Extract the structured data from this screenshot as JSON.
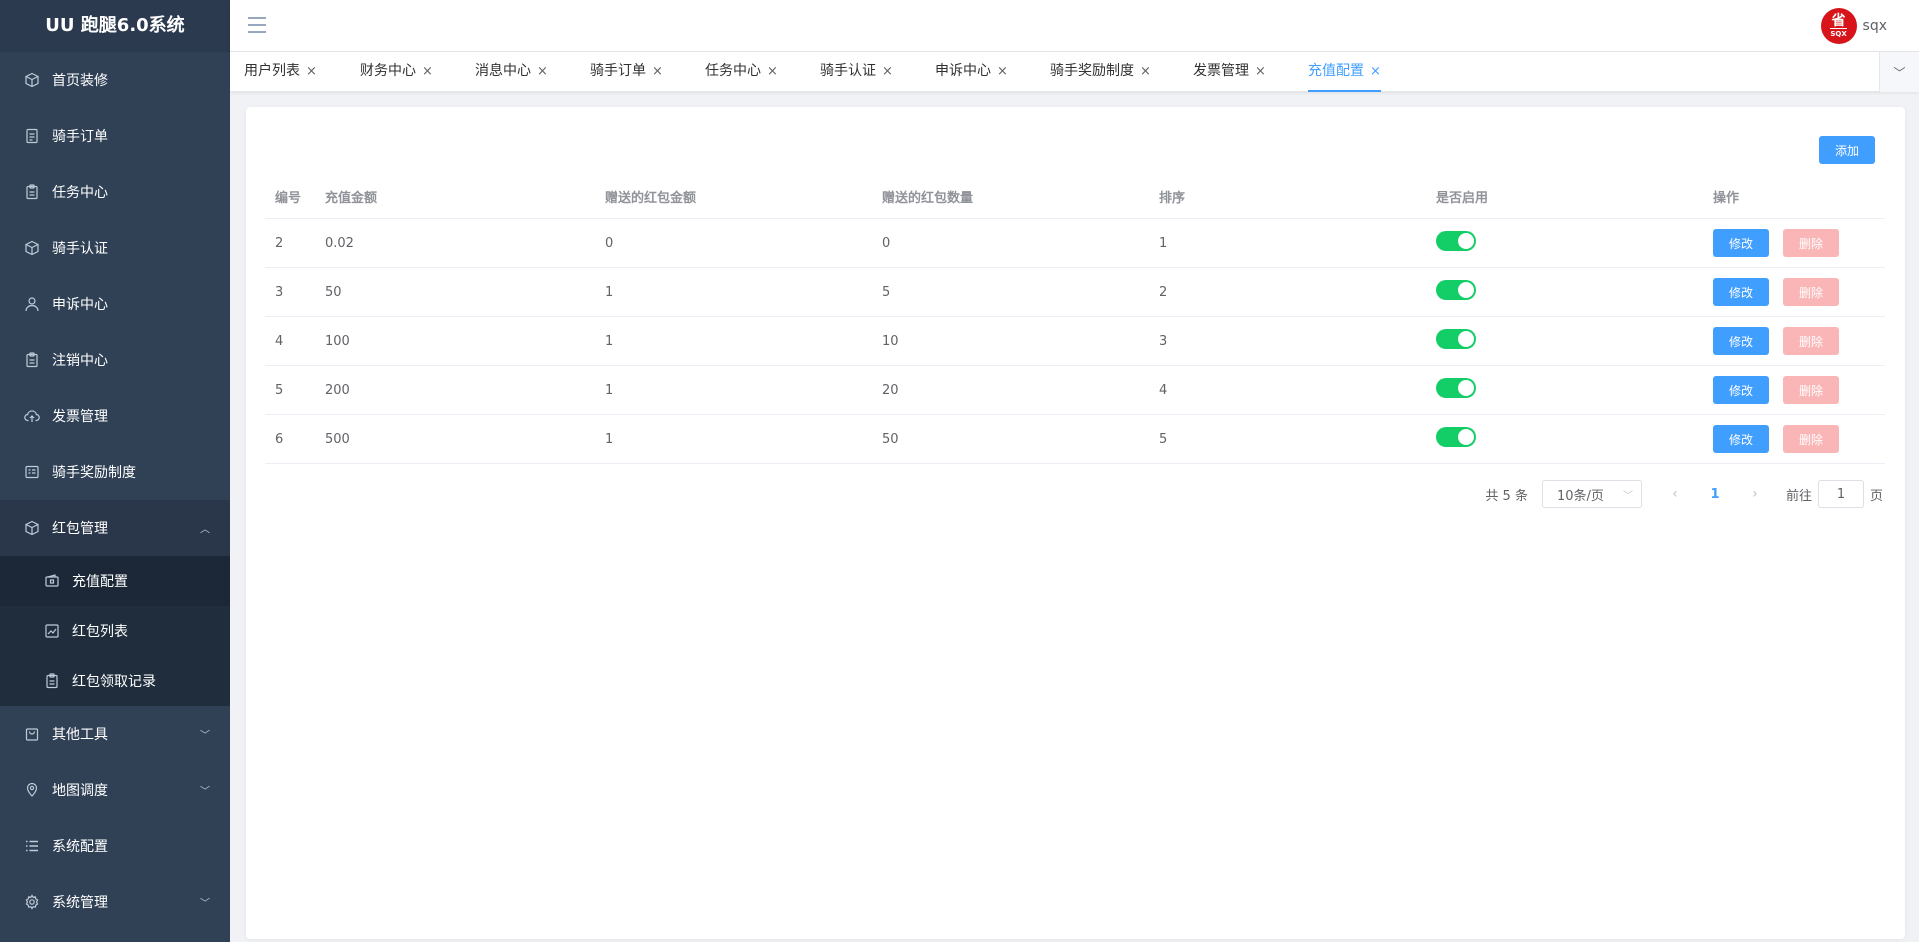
{
  "app": {
    "title": "UU 跑腿6.0系统"
  },
  "header": {
    "username": "sqx",
    "avatar_char": "省",
    "avatar_sub": "SQX"
  },
  "sidebar": {
    "items": [
      {
        "label": "首页装修",
        "icon": "cube-icon"
      },
      {
        "label": "骑手订单",
        "icon": "document-icon"
      },
      {
        "label": "任务中心",
        "icon": "clipboard-icon"
      },
      {
        "label": "骑手认证",
        "icon": "cube-icon"
      },
      {
        "label": "申诉中心",
        "icon": "user-icon"
      },
      {
        "label": "注销中心",
        "icon": "clipboard-icon"
      },
      {
        "label": "发票管理",
        "icon": "cloud-upload-icon"
      },
      {
        "label": "骑手奖励制度",
        "icon": "list-card-icon"
      }
    ],
    "group_open": {
      "label": "红包管理",
      "icon": "cube-icon",
      "arrow": "︿"
    },
    "sub_items": [
      {
        "label": "充值配置",
        "icon": "wallet-icon"
      },
      {
        "label": "红包列表",
        "icon": "chart-icon"
      },
      {
        "label": "红包领取记录",
        "icon": "clipboard-icon"
      }
    ],
    "tail_items": [
      {
        "label": "其他工具",
        "icon": "bag-icon",
        "arrow": "﹀"
      },
      {
        "label": "地图调度",
        "icon": "location-icon",
        "arrow": "﹀"
      },
      {
        "label": "系统配置",
        "icon": "list-icon",
        "arrow": ""
      },
      {
        "label": "系统管理",
        "icon": "gear-icon",
        "arrow": "﹀"
      }
    ]
  },
  "tabs": [
    {
      "label": "用户列表"
    },
    {
      "label": "财务中心"
    },
    {
      "label": "消息中心"
    },
    {
      "label": "骑手订单"
    },
    {
      "label": "任务中心"
    },
    {
      "label": "骑手认证"
    },
    {
      "label": "申诉中心"
    },
    {
      "label": "骑手奖励制度"
    },
    {
      "label": "发票管理"
    },
    {
      "label": "充值配置"
    }
  ],
  "tab_close_glyph": "×",
  "toolbar": {
    "add_label": "添加"
  },
  "table": {
    "columns": [
      "编号",
      "充值金额",
      "赠送的红包金额",
      "赠送的红包数量",
      "排序",
      "是否启用",
      "操作"
    ],
    "rows": [
      {
        "id": "2",
        "amount": "0.02",
        "bonus_amount": "0",
        "bonus_count": "0",
        "sort": "1",
        "enabled": true
      },
      {
        "id": "3",
        "amount": "50",
        "bonus_amount": "1",
        "bonus_count": "5",
        "sort": "2",
        "enabled": true
      },
      {
        "id": "4",
        "amount": "100",
        "bonus_amount": "1",
        "bonus_count": "10",
        "sort": "3",
        "enabled": true
      },
      {
        "id": "5",
        "amount": "200",
        "bonus_amount": "1",
        "bonus_count": "20",
        "sort": "4",
        "enabled": true
      },
      {
        "id": "6",
        "amount": "500",
        "bonus_amount": "1",
        "bonus_count": "50",
        "sort": "5",
        "enabled": true
      }
    ],
    "edit_label": "修改",
    "delete_label": "删除"
  },
  "pagination": {
    "total": "共 5 条",
    "page_size": "10条/页",
    "current_page": "1",
    "goto_prefix": "前往",
    "goto_value": "1",
    "goto_suffix": "页",
    "prev_glyph": "‹",
    "next_glyph": "›"
  },
  "colors": {
    "primary": "#409eff",
    "sidebar_bg": "#304156",
    "switch_on": "#13ce66",
    "danger_light": "#fab6b6"
  }
}
